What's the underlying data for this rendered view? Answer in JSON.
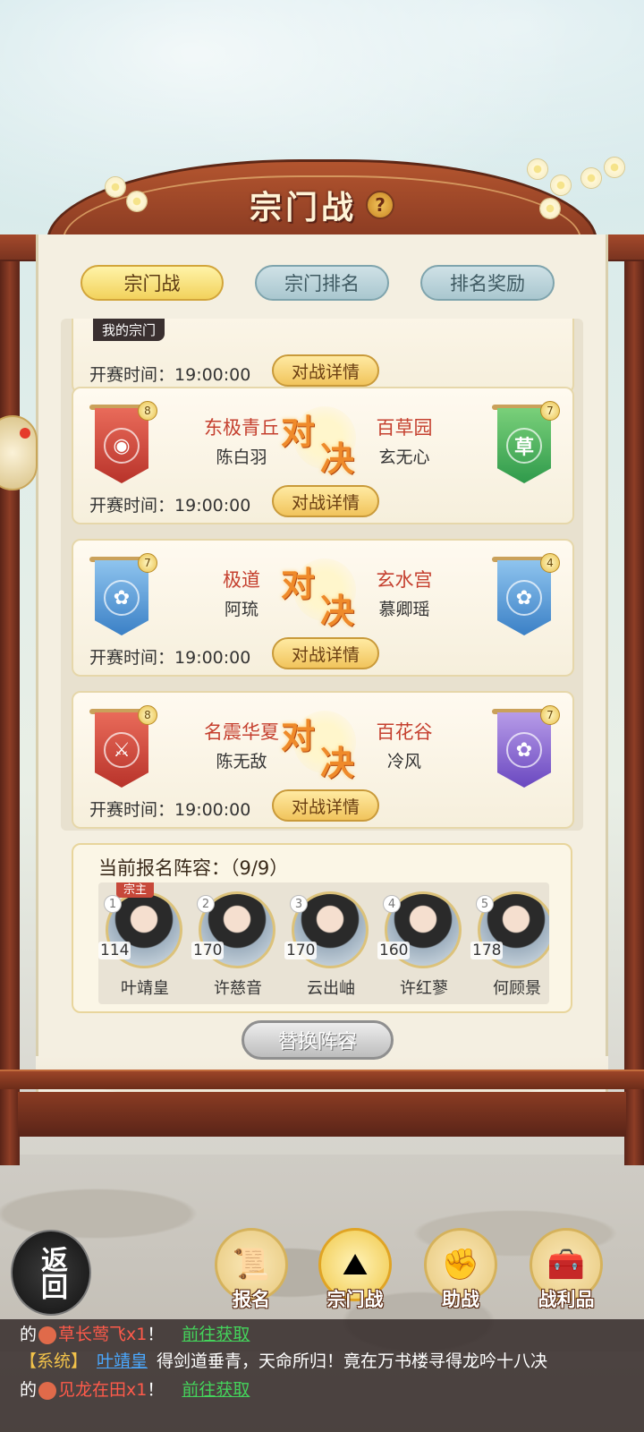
{
  "page": {
    "title": "宗门战"
  },
  "tabs": [
    {
      "label": "宗门战",
      "active": true
    },
    {
      "label": "宗门排名",
      "active": false
    },
    {
      "label": "排名奖励",
      "active": false
    }
  ],
  "my_sect": {
    "tag": "我的宗门",
    "start_label": "开赛时间：",
    "start_time": "19:00:00",
    "detail_label": "对战详情"
  },
  "vs_chars": [
    "对",
    "决"
  ],
  "matches": [
    {
      "left": {
        "sect": "东极青丘",
        "leader": "陈白羽",
        "level": "8",
        "flag_color": "#c93a2e",
        "emblem": "coin-icon"
      },
      "right": {
        "sect": "百草园",
        "leader": "玄无心",
        "level": "7",
        "flag_color": "#2f9a4b",
        "emblem_text": "草"
      },
      "start_label": "开赛时间：",
      "start_time": "19:00:00",
      "detail_label": "对战详情"
    },
    {
      "left": {
        "sect": "极道",
        "leader": "阿琉",
        "level": "7",
        "flag_color": "#3b80c6",
        "emblem": "lotus-icon"
      },
      "right": {
        "sect": "玄水宫",
        "leader": "慕卿瑶",
        "level": "4",
        "flag_color": "#3b80c6",
        "emblem": "lotus-icon"
      },
      "start_label": "开赛时间：",
      "start_time": "19:00:00",
      "detail_label": "对战详情"
    },
    {
      "left": {
        "sect": "名震华夏",
        "leader": "陈无敌",
        "level": "8",
        "flag_color": "#c93a2e",
        "emblem": "crossed-swords-icon"
      },
      "right": {
        "sect": "百花谷",
        "leader": "冷风",
        "level": "7",
        "flag_color": "#6a48c0",
        "emblem": "lotus-icon"
      },
      "start_label": "开赛时间：",
      "start_time": "19:00:00",
      "detail_label": "对战详情"
    }
  ],
  "lineup": {
    "title": "当前报名阵容：（9/9）",
    "leader_tag": "宗主",
    "heroes": [
      {
        "index": "1",
        "level": "114",
        "name": "叶靖皇"
      },
      {
        "index": "2",
        "level": "170",
        "name": "许慈音"
      },
      {
        "index": "3",
        "level": "170",
        "name": "云出岫"
      },
      {
        "index": "4",
        "level": "160",
        "name": "许红蓼"
      },
      {
        "index": "5",
        "level": "178",
        "name": "何顾景"
      }
    ],
    "swap_label": "替换阵容"
  },
  "nav": {
    "back": "返回",
    "items": [
      {
        "label": "报名",
        "icon": "scroll-brush-icon",
        "active": false
      },
      {
        "label": "宗门战",
        "icon": "flag-mountain-icon",
        "active": true
      },
      {
        "label": "助战",
        "icon": "handshake-icon",
        "active": false
      },
      {
        "label": "战利品",
        "icon": "treasure-chest-icon",
        "active": false
      }
    ]
  },
  "chat": {
    "line1": {
      "prefix": "的",
      "item": "草长莺飞x1",
      "suffix": "！",
      "link": "前往获取"
    },
    "line2": {
      "tag": "【系统】",
      "player": "叶靖皇",
      "text": "得剑道垂青，天命所归！竟在万书楼寻得龙吟十八决"
    },
    "line3": {
      "prefix": "的",
      "item": "见龙在田x1",
      "suffix": "！",
      "link": "前往获取"
    }
  }
}
